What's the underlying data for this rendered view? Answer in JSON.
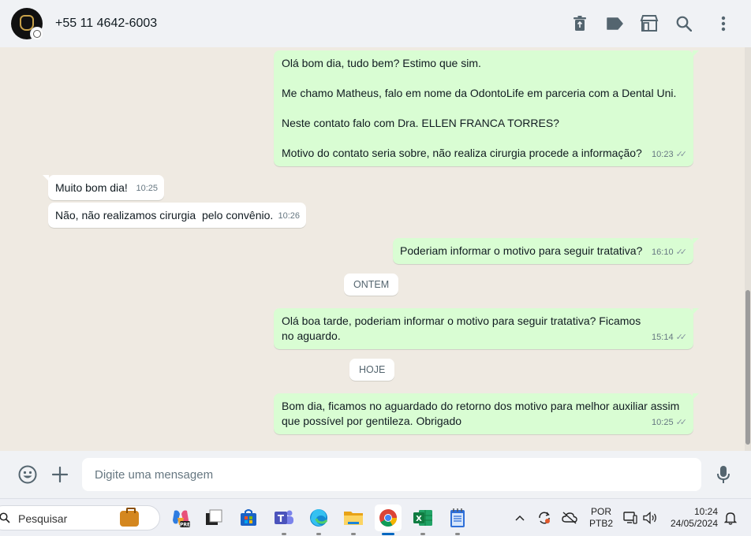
{
  "header": {
    "contact_name": "+55 11 4642-6003",
    "icons": [
      "delete-icon",
      "label-icon",
      "store-icon",
      "search-icon",
      "menu-icon"
    ]
  },
  "messages": [
    {
      "direction": "out",
      "paragraphs": [
        "Olá bom dia, tudo bem? Estimo que sim.",
        "Me chamo Matheus, falo em nome da OdontoLife em parceria com a Dental Uni.",
        "Neste contato falo com Dra. ELLEN FRANCA TORRES?",
        "Motivo do contato seria sobre, não realiza cirurgia procede a informação?"
      ],
      "time": "10:23"
    },
    {
      "direction": "in",
      "text": "Muito bom dia!",
      "time": "10:25"
    },
    {
      "direction": "in",
      "text": "Não, não realizamos cirurgia  pelo convênio.",
      "time": "10:26"
    },
    {
      "direction": "out",
      "text": "Poderiam informar o motivo para seguir tratativa?",
      "time": "16:10"
    },
    {
      "direction": "out",
      "text": "Olá boa tarde, poderiam informar o motivo para seguir tratativa? Ficamos no aguardo.",
      "time": "15:14"
    },
    {
      "direction": "out",
      "text": "Bom dia, ficamos no aguardado do retorno dos motivo para melhor auxiliar assim que possível por gentileza. Obrigado",
      "time": "10:25"
    }
  ],
  "date_chips": [
    "ONTEM",
    "HOJE"
  ],
  "composer": {
    "placeholder": "Digite uma mensagem"
  },
  "taskbar": {
    "search_label": "Pesquisar",
    "apps": [
      "copilot-icon",
      "task-view-icon",
      "store-icon",
      "teams-icon",
      "edge-icon",
      "file-explorer-icon",
      "chrome-icon",
      "excel-icon",
      "notepad-icon"
    ],
    "language": [
      "POR",
      "PTB2"
    ],
    "time": "10:24",
    "date": "24/05/2024"
  },
  "colors": {
    "outgoing_bubble": "#d9fdd3",
    "incoming_bubble": "#ffffff",
    "chat_background": "#efeae2",
    "header_background": "#f0f2f5"
  }
}
